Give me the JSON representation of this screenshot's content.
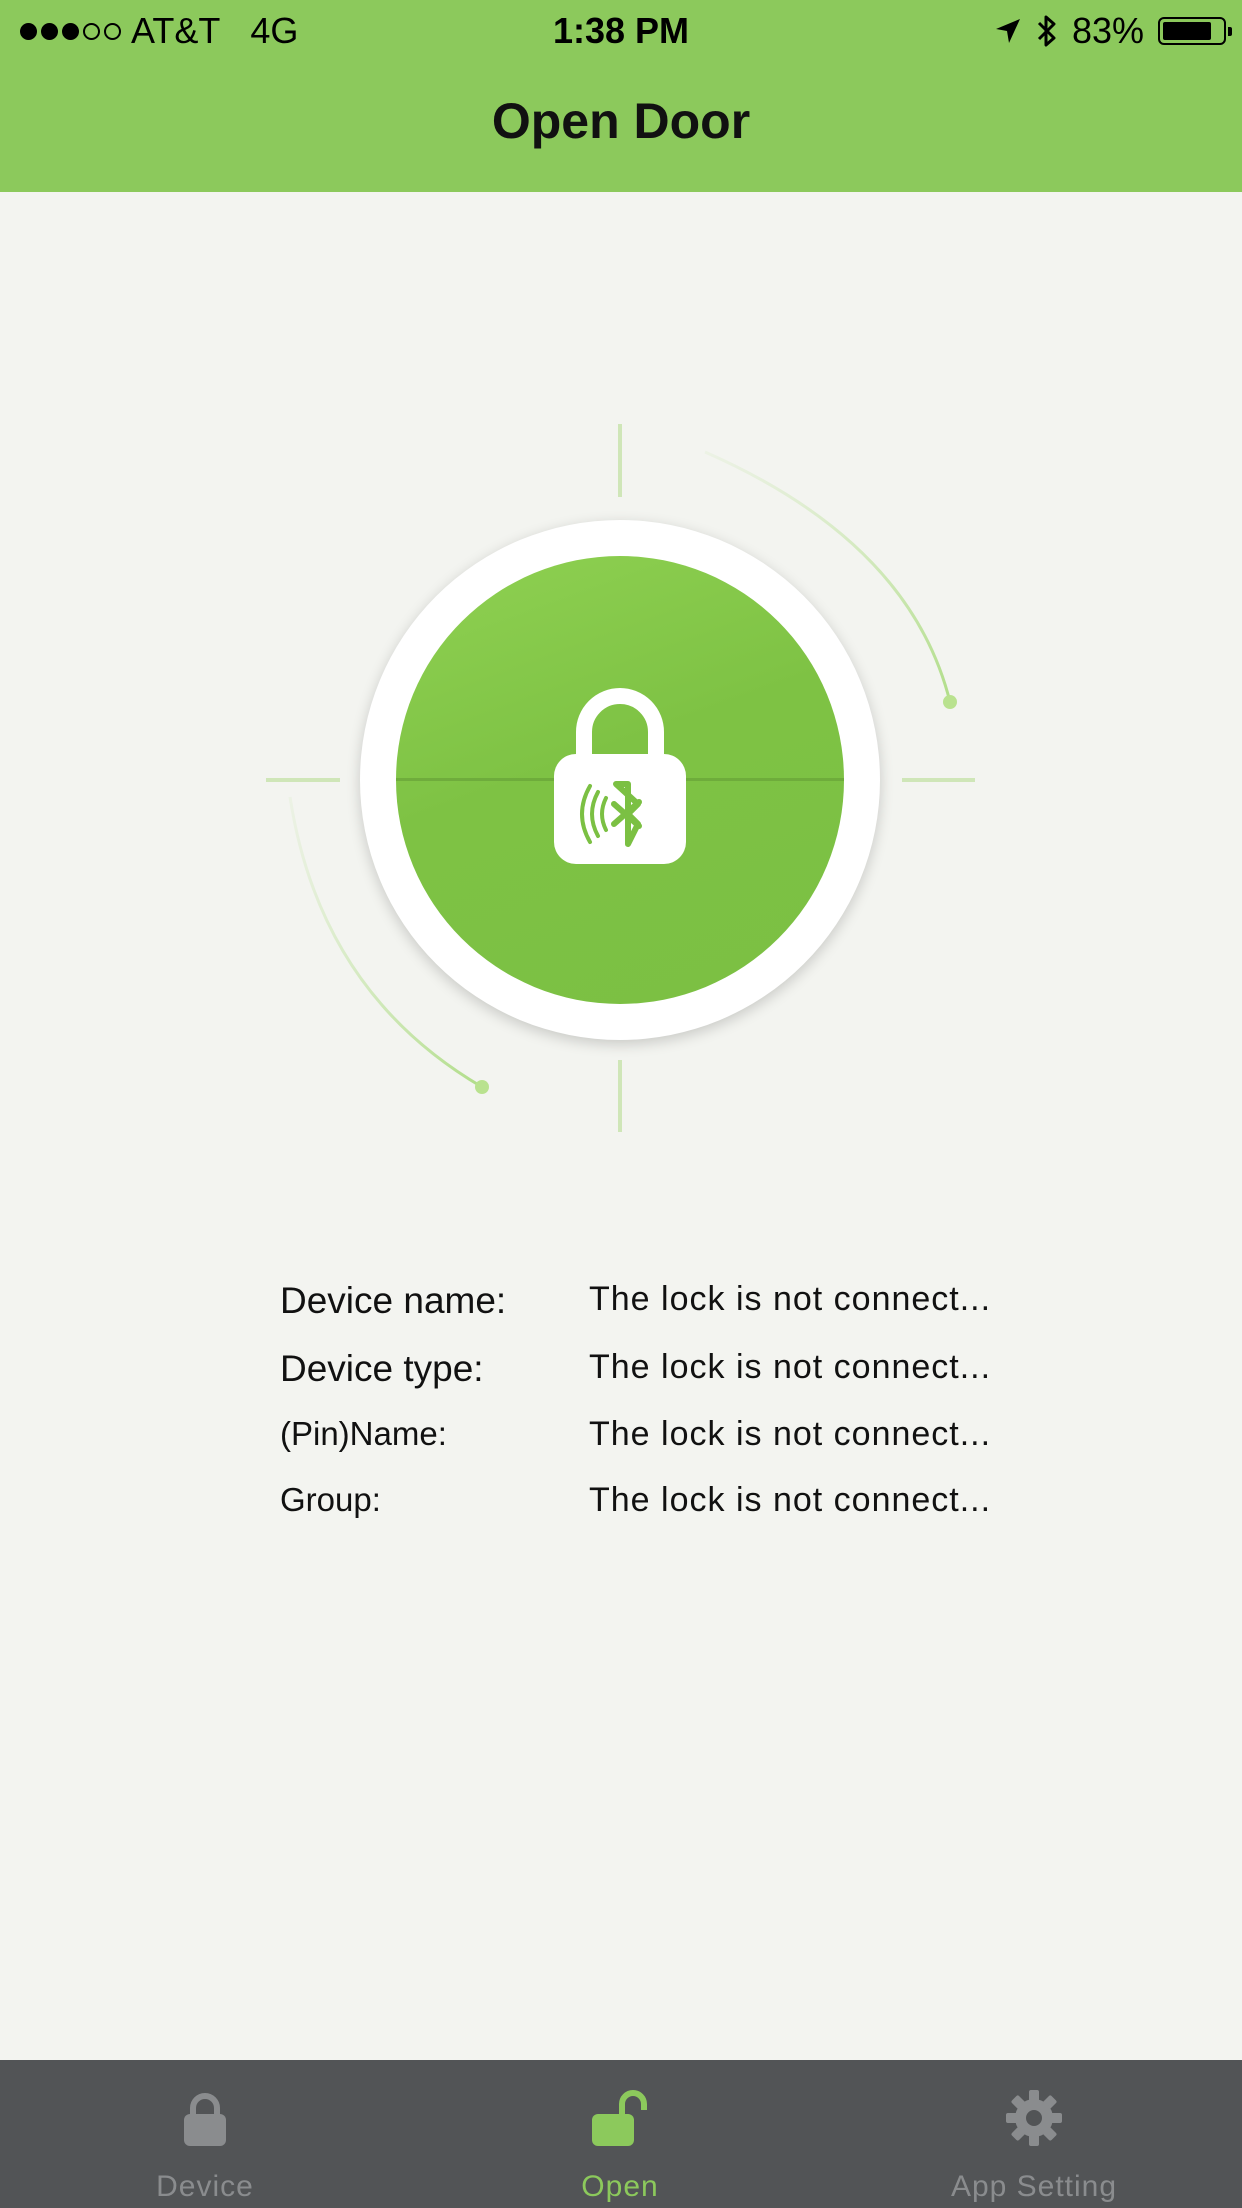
{
  "status_bar": {
    "signal_dots_filled": 3,
    "signal_dots_total": 5,
    "carrier": "AT&T",
    "network": "4G",
    "time": "1:38 PM",
    "battery": "83%",
    "battery_level": 0.83
  },
  "header": {
    "title": "Open Door"
  },
  "lock_button": {
    "icon": "padlock-bluetooth-icon"
  },
  "device_info": [
    {
      "label": "Device name:",
      "value": "The lock is not connect..."
    },
    {
      "label": "Device type:",
      "value": "The lock is not connect..."
    },
    {
      "label": "(Pin)Name:",
      "value": "The lock is not connect..."
    },
    {
      "label": "Group:",
      "value": "The lock is not connect..."
    }
  ],
  "tab_bar": {
    "tabs": [
      {
        "label": "Device",
        "icon": "lock-icon",
        "active": false
      },
      {
        "label": "Open",
        "icon": "unlock-icon",
        "active": true
      },
      {
        "label": "App Setting",
        "icon": "gear-icon",
        "active": false
      }
    ]
  },
  "colors": {
    "accent": "#8cc95c",
    "button_green": "#7bc043",
    "tab_bar": "#525456",
    "inactive_tab": "#8a8c8e",
    "background": "#f3f4f0"
  }
}
